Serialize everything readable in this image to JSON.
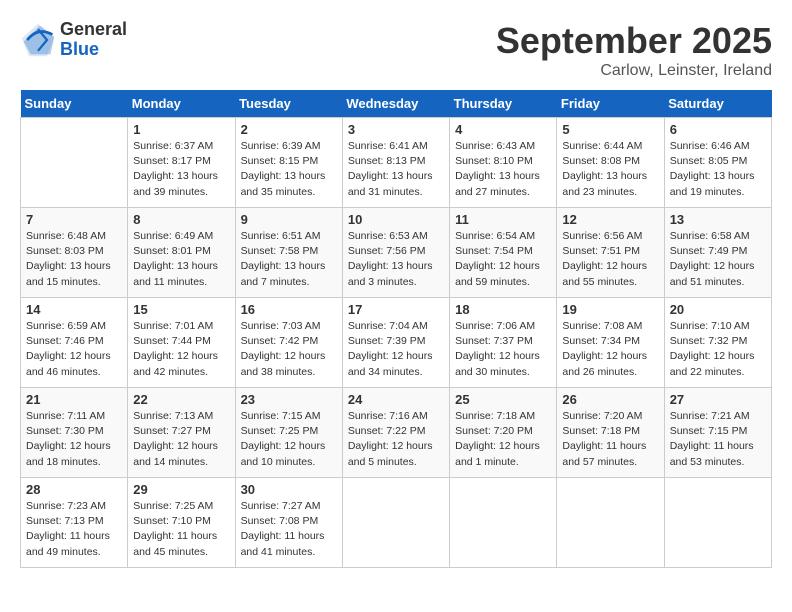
{
  "header": {
    "logo_general": "General",
    "logo_blue": "Blue",
    "month_title": "September 2025",
    "location": "Carlow, Leinster, Ireland"
  },
  "days_of_week": [
    "Sunday",
    "Monday",
    "Tuesday",
    "Wednesday",
    "Thursday",
    "Friday",
    "Saturday"
  ],
  "weeks": [
    [
      {
        "day": "",
        "info": ""
      },
      {
        "day": "1",
        "info": "Sunrise: 6:37 AM\nSunset: 8:17 PM\nDaylight: 13 hours\nand 39 minutes."
      },
      {
        "day": "2",
        "info": "Sunrise: 6:39 AM\nSunset: 8:15 PM\nDaylight: 13 hours\nand 35 minutes."
      },
      {
        "day": "3",
        "info": "Sunrise: 6:41 AM\nSunset: 8:13 PM\nDaylight: 13 hours\nand 31 minutes."
      },
      {
        "day": "4",
        "info": "Sunrise: 6:43 AM\nSunset: 8:10 PM\nDaylight: 13 hours\nand 27 minutes."
      },
      {
        "day": "5",
        "info": "Sunrise: 6:44 AM\nSunset: 8:08 PM\nDaylight: 13 hours\nand 23 minutes."
      },
      {
        "day": "6",
        "info": "Sunrise: 6:46 AM\nSunset: 8:05 PM\nDaylight: 13 hours\nand 19 minutes."
      }
    ],
    [
      {
        "day": "7",
        "info": "Sunrise: 6:48 AM\nSunset: 8:03 PM\nDaylight: 13 hours\nand 15 minutes."
      },
      {
        "day": "8",
        "info": "Sunrise: 6:49 AM\nSunset: 8:01 PM\nDaylight: 13 hours\nand 11 minutes."
      },
      {
        "day": "9",
        "info": "Sunrise: 6:51 AM\nSunset: 7:58 PM\nDaylight: 13 hours\nand 7 minutes."
      },
      {
        "day": "10",
        "info": "Sunrise: 6:53 AM\nSunset: 7:56 PM\nDaylight: 13 hours\nand 3 minutes."
      },
      {
        "day": "11",
        "info": "Sunrise: 6:54 AM\nSunset: 7:54 PM\nDaylight: 12 hours\nand 59 minutes."
      },
      {
        "day": "12",
        "info": "Sunrise: 6:56 AM\nSunset: 7:51 PM\nDaylight: 12 hours\nand 55 minutes."
      },
      {
        "day": "13",
        "info": "Sunrise: 6:58 AM\nSunset: 7:49 PM\nDaylight: 12 hours\nand 51 minutes."
      }
    ],
    [
      {
        "day": "14",
        "info": "Sunrise: 6:59 AM\nSunset: 7:46 PM\nDaylight: 12 hours\nand 46 minutes."
      },
      {
        "day": "15",
        "info": "Sunrise: 7:01 AM\nSunset: 7:44 PM\nDaylight: 12 hours\nand 42 minutes."
      },
      {
        "day": "16",
        "info": "Sunrise: 7:03 AM\nSunset: 7:42 PM\nDaylight: 12 hours\nand 38 minutes."
      },
      {
        "day": "17",
        "info": "Sunrise: 7:04 AM\nSunset: 7:39 PM\nDaylight: 12 hours\nand 34 minutes."
      },
      {
        "day": "18",
        "info": "Sunrise: 7:06 AM\nSunset: 7:37 PM\nDaylight: 12 hours\nand 30 minutes."
      },
      {
        "day": "19",
        "info": "Sunrise: 7:08 AM\nSunset: 7:34 PM\nDaylight: 12 hours\nand 26 minutes."
      },
      {
        "day": "20",
        "info": "Sunrise: 7:10 AM\nSunset: 7:32 PM\nDaylight: 12 hours\nand 22 minutes."
      }
    ],
    [
      {
        "day": "21",
        "info": "Sunrise: 7:11 AM\nSunset: 7:30 PM\nDaylight: 12 hours\nand 18 minutes."
      },
      {
        "day": "22",
        "info": "Sunrise: 7:13 AM\nSunset: 7:27 PM\nDaylight: 12 hours\nand 14 minutes."
      },
      {
        "day": "23",
        "info": "Sunrise: 7:15 AM\nSunset: 7:25 PM\nDaylight: 12 hours\nand 10 minutes."
      },
      {
        "day": "24",
        "info": "Sunrise: 7:16 AM\nSunset: 7:22 PM\nDaylight: 12 hours\nand 5 minutes."
      },
      {
        "day": "25",
        "info": "Sunrise: 7:18 AM\nSunset: 7:20 PM\nDaylight: 12 hours\nand 1 minute."
      },
      {
        "day": "26",
        "info": "Sunrise: 7:20 AM\nSunset: 7:18 PM\nDaylight: 11 hours\nand 57 minutes."
      },
      {
        "day": "27",
        "info": "Sunrise: 7:21 AM\nSunset: 7:15 PM\nDaylight: 11 hours\nand 53 minutes."
      }
    ],
    [
      {
        "day": "28",
        "info": "Sunrise: 7:23 AM\nSunset: 7:13 PM\nDaylight: 11 hours\nand 49 minutes."
      },
      {
        "day": "29",
        "info": "Sunrise: 7:25 AM\nSunset: 7:10 PM\nDaylight: 11 hours\nand 45 minutes."
      },
      {
        "day": "30",
        "info": "Sunrise: 7:27 AM\nSunset: 7:08 PM\nDaylight: 11 hours\nand 41 minutes."
      },
      {
        "day": "",
        "info": ""
      },
      {
        "day": "",
        "info": ""
      },
      {
        "day": "",
        "info": ""
      },
      {
        "day": "",
        "info": ""
      }
    ]
  ]
}
